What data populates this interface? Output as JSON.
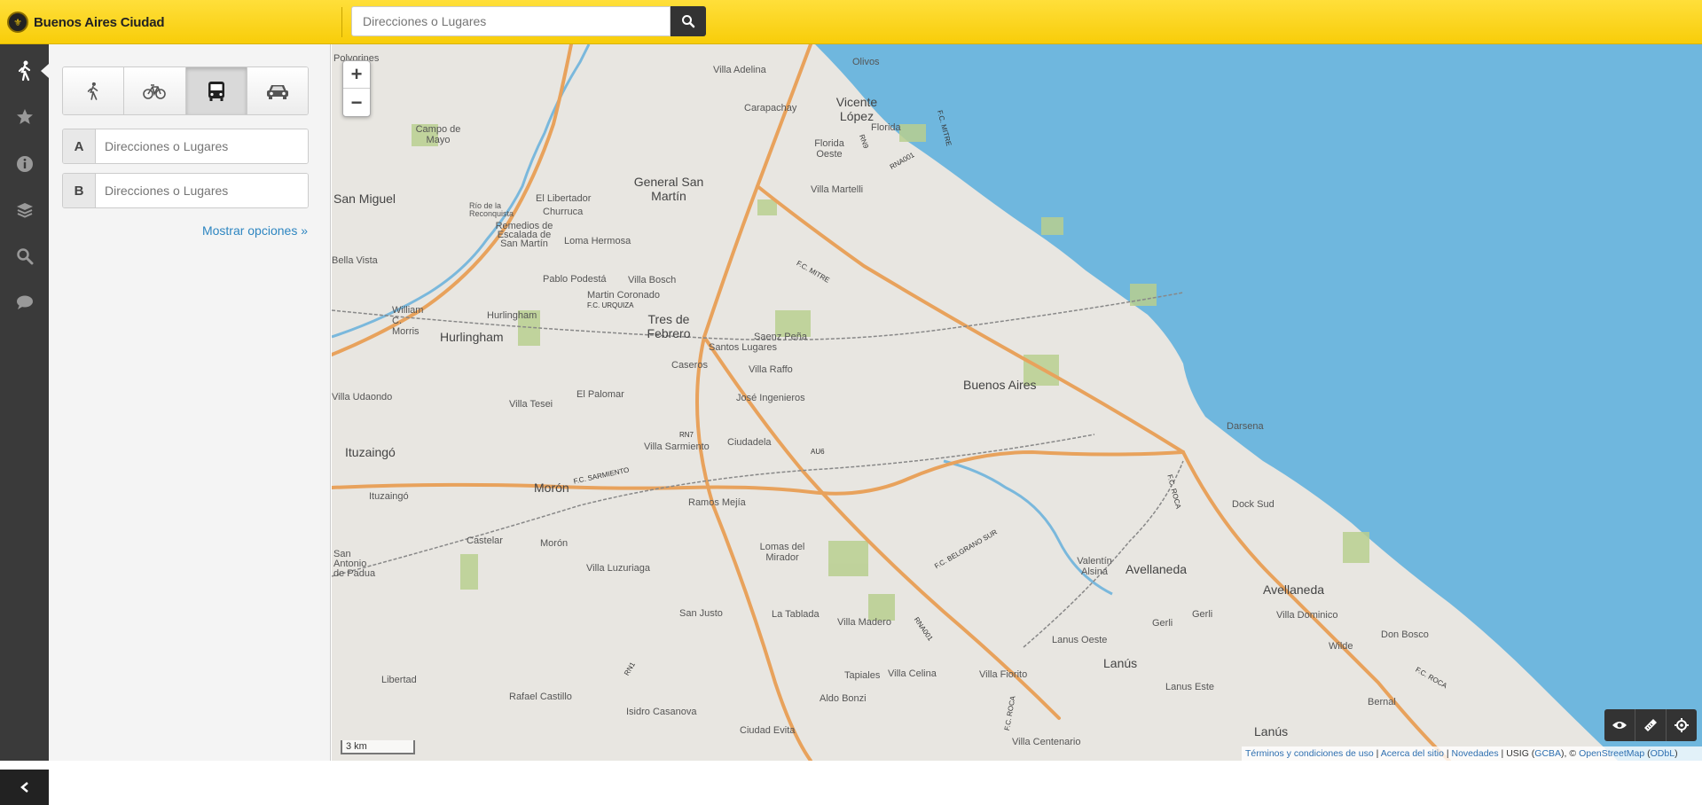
{
  "header": {
    "brand": "Buenos Aires Ciudad",
    "search_placeholder": "Direcciones o Lugares"
  },
  "rail": {
    "items": [
      "walk-icon",
      "star-icon",
      "info-icon",
      "layers-icon",
      "search-icon",
      "chat-icon"
    ],
    "active": "walk-icon"
  },
  "panel": {
    "modes": [
      "walk-icon",
      "bike-icon",
      "bus-icon",
      "car-icon"
    ],
    "selected_mode": "bus-icon",
    "origin_label": "A",
    "origin_placeholder": "Direcciones o Lugares",
    "dest_label": "B",
    "dest_placeholder": "Direcciones o Lugares",
    "more_options": "Mostrar opciones »"
  },
  "map": {
    "zoom_in": "+",
    "zoom_out": "−",
    "scale": "3 km",
    "attribution": {
      "terms": "Términos y condiciones de uso",
      "about": "Acerca del sitio",
      "news": "Novedades",
      "usig": "USIG",
      "gcba": "GCBA",
      "copy": "©",
      "osm": "OpenStreetMap",
      "odbl": "ODbL"
    },
    "colors": {
      "water": "#6fb7de",
      "land": "#e8e6e1",
      "highway": "#e8a25c",
      "park": "#b8cf8f"
    },
    "labels": {
      "san_miguel": "San Miguel",
      "hurlingham": "Hurlingham",
      "hurlingham_small": "Hurlingham",
      "general_san_martin": "General San Martín",
      "tres_de_febrero": "Tres de Febrero",
      "buenos_aires": "Buenos Aires",
      "ituzaingo": "Ituzaingó",
      "ituzaingo_small": "Ituzaingó",
      "moron": "Morón",
      "moron_small": "Morón",
      "avellaneda": "Avellaneda",
      "avellaneda_city": "Avellaneda",
      "lanus": "Lanús",
      "lanus_bottom": "Lanús",
      "vicente_lopez": "Vicente López",
      "olivos": "Olivos",
      "villa_adelina": "Villa Adelina",
      "carapachay": "Carapachay",
      "florida": "Florida",
      "florida_oeste": "Florida Oeste",
      "villa_martelli": "Villa Martelli",
      "saenz_pena": "Saenz Peña",
      "santos_lugares": "Santos Lugares",
      "villa_raffo": "Villa Raffo",
      "caseros": "Caseros",
      "jose_ingenieros": "José Ingenieros",
      "el_palomar": "El Palomar",
      "villa_sarmiento": "Villa Sarmiento",
      "ciudadela": "Ciudadela",
      "ramos_mejia": "Ramos Mejía",
      "lomas_del_mirador": "Lomas del Mirador",
      "villa_luzuriaga": "Villa Luzuriaga",
      "san_justo": "San Justo",
      "la_tablada": "La Tablada",
      "villa_madero": "Villa Madero",
      "tapiales": "Tapiales",
      "villa_celina": "Villa Celina",
      "villa_fiorito": "Villa Fiorito",
      "isidro_casanova": "Isidro Casanova",
      "rafael_castillo": "Rafael Castillo",
      "libertad": "Libertad",
      "castelar": "Castelar",
      "villa_udaondo": "Villa Udaondo",
      "villa_tesei": "Villa Tesei",
      "bella_vista": "Bella Vista",
      "william_c_morris": "William C. Morris",
      "dock_sud": "Dock Sud",
      "darsena": "Darsena",
      "valentin_alsina": "Valentín Alsina",
      "lanus_oeste": "Lanus Oeste",
      "lanus_este": "Lanus Este",
      "gerli": "Gerli",
      "gerli_east": "Gerli",
      "villa_dominico": "Villa Dominico",
      "wilde": "Wilde",
      "don_bosco": "Don Bosco",
      "bernal": "Bernal",
      "villa_centenario": "Villa Centenario",
      "ciudad_evita": "Ciudad Evita",
      "aldo_bonzi": "Aldo Bonzi",
      "campo_de_mayo": "Campo de Mayo",
      "polvorines": "Polvorines",
      "el_libertador": "El Libertador",
      "churruca": "Churruca",
      "loma_hermosa": "Loma Hermosa",
      "pablo_podesta": "Pablo Podestá",
      "martin_coronado": "Martin Coronado",
      "villa_bosch": "Villa Bosch",
      "remedios_de_escalada": "Remedios de Escalada de San Martín",
      "rio_reconquista": "Río de la Reconquista",
      "san_antonio_de_padua": "San Antonio de Padua",
      "fc_mitre": "F.C. MITRE",
      "fc_mitre_north": "F.C. MITRE",
      "fc_urquiza": "F.C. URQUIZA",
      "fc_sarmiento": "F.C. SARMIENTO",
      "fc_belgrano_sur": "F.C. BELGRANO SUR",
      "fc_roca": "F.C. ROCA",
      "fc_roca_south": "F.C. ROCA",
      "fc_roca_east": "F.C. ROCA",
      "rn7": "RN7",
      "rn9": "RN9",
      "rna001": "RNA001",
      "rna001_south": "RNA001",
      "au6": "AU6",
      "rn1": "RN1"
    }
  }
}
